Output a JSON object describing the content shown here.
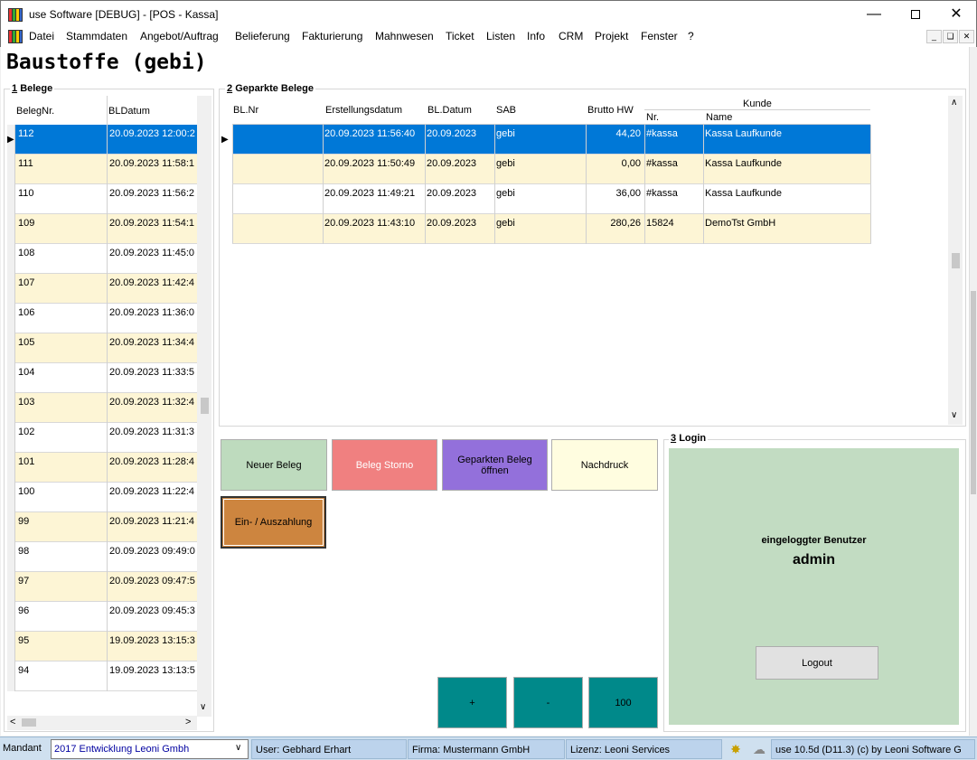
{
  "window": {
    "title": "use Software [DEBUG] - [POS - Kassa]",
    "minimize_icon": "minimize-icon",
    "maximize_icon": "maximize-icon",
    "close_icon": "close-icon"
  },
  "menu": {
    "items": [
      "Datei",
      "Stammdaten",
      "Angebot/Auftrag",
      "Belieferung",
      "Fakturierung",
      "Mahnwesen",
      "Ticket",
      "Listen",
      "Info",
      "CRM",
      "Projekt",
      "Fenster",
      "?"
    ]
  },
  "page": {
    "title": "Baustoffe (gebi)"
  },
  "belege": {
    "group_label": "Belege",
    "group_number": "1",
    "columns": [
      "BelegNr.",
      "BLDatum"
    ],
    "rows": [
      {
        "nr": "112",
        "datum": "20.09.2023 12:00:2"
      },
      {
        "nr": "111",
        "datum": "20.09.2023 11:58:1"
      },
      {
        "nr": "110",
        "datum": "20.09.2023 11:56:2"
      },
      {
        "nr": "109",
        "datum": "20.09.2023 11:54:1"
      },
      {
        "nr": "108",
        "datum": "20.09.2023 11:45:0"
      },
      {
        "nr": "107",
        "datum": "20.09.2023 11:42:4"
      },
      {
        "nr": "106",
        "datum": "20.09.2023 11:36:0"
      },
      {
        "nr": "105",
        "datum": "20.09.2023 11:34:4"
      },
      {
        "nr": "104",
        "datum": "20.09.2023 11:33:5"
      },
      {
        "nr": "103",
        "datum": "20.09.2023 11:32:4"
      },
      {
        "nr": "102",
        "datum": "20.09.2023 11:31:3"
      },
      {
        "nr": "101",
        "datum": "20.09.2023 11:28:4"
      },
      {
        "nr": "100",
        "datum": "20.09.2023 11:22:4"
      },
      {
        "nr": "99",
        "datum": "20.09.2023 11:21:4"
      },
      {
        "nr": "98",
        "datum": "20.09.2023 09:49:0"
      },
      {
        "nr": "97",
        "datum": "20.09.2023 09:47:5"
      },
      {
        "nr": "96",
        "datum": "20.09.2023 09:45:3"
      },
      {
        "nr": "95",
        "datum": "19.09.2023 13:15:3"
      },
      {
        "nr": "94",
        "datum": "19.09.2023 13:13:5"
      }
    ]
  },
  "geparkte": {
    "group_label": "Geparkte Belege",
    "group_number": "2",
    "columns": {
      "bl_nr": "BL.Nr",
      "erstellungsdatum": "Erstellungsdatum",
      "bl_datum": "BL.Datum",
      "sab": "SAB",
      "brutto": "Brutto HW",
      "kunde": "Kunde",
      "kunde_nr": "Nr.",
      "kunde_name": "Name"
    },
    "rows": [
      {
        "bl_nr": "",
        "erstellungsdatum": "20.09.2023 11:56:40",
        "bl_datum": "20.09.2023",
        "sab": "gebi",
        "brutto": "44,20",
        "kunde_nr": "#kassa",
        "kunde_name": "Kassa Laufkunde"
      },
      {
        "bl_nr": "",
        "erstellungsdatum": "20.09.2023 11:50:49",
        "bl_datum": "20.09.2023",
        "sab": "gebi",
        "brutto": "0,00",
        "kunde_nr": "#kassa",
        "kunde_name": "Kassa Laufkunde"
      },
      {
        "bl_nr": "",
        "erstellungsdatum": "20.09.2023 11:49:21",
        "bl_datum": "20.09.2023",
        "sab": "gebi",
        "brutto": "36,00",
        "kunde_nr": "#kassa",
        "kunde_name": "Kassa Laufkunde"
      },
      {
        "bl_nr": "",
        "erstellungsdatum": "20.09.2023 11:43:10",
        "bl_datum": "20.09.2023",
        "sab": "gebi",
        "brutto": "280,26",
        "kunde_nr": "15824",
        "kunde_name": "DemoTst GmbH"
      }
    ]
  },
  "actions": {
    "neuer_beleg": "Neuer Beleg",
    "beleg_storno": "Beleg Storno",
    "geparkten_beleg": "Geparkten Beleg\nöffnen",
    "nachdruck": "Nachdruck",
    "ein_auszahlung": "Ein- / Auszahlung",
    "plus": "+",
    "minus": "-",
    "hundred": "100"
  },
  "login": {
    "group_label": "Login",
    "group_number": "3",
    "caption": "eingeloggter Benutzer",
    "user": "admin",
    "logout": "Logout"
  },
  "statusbar": {
    "mandant_label": "Mandant",
    "mandant_value": "2017  Entwicklung Leoni Gmbh",
    "user": "User: Gebhard Erhart",
    "firma": "Firma: Mustermann GmbH",
    "lizenz": "Lizenz: Leoni Services",
    "version": "use 10.5d (D11.3) (c) by Leoni Software G"
  },
  "colors": {
    "selected_row": "#0078d7",
    "alt_row": "#fdf5d5",
    "neuer_beleg": "#bedbbe",
    "storno": "#f08080",
    "geparkt": "#9370db",
    "nachdruck": "#fffde0",
    "ein_aus": "#cd853f",
    "teal": "#00898a",
    "login_bg": "#c2dcc2"
  }
}
